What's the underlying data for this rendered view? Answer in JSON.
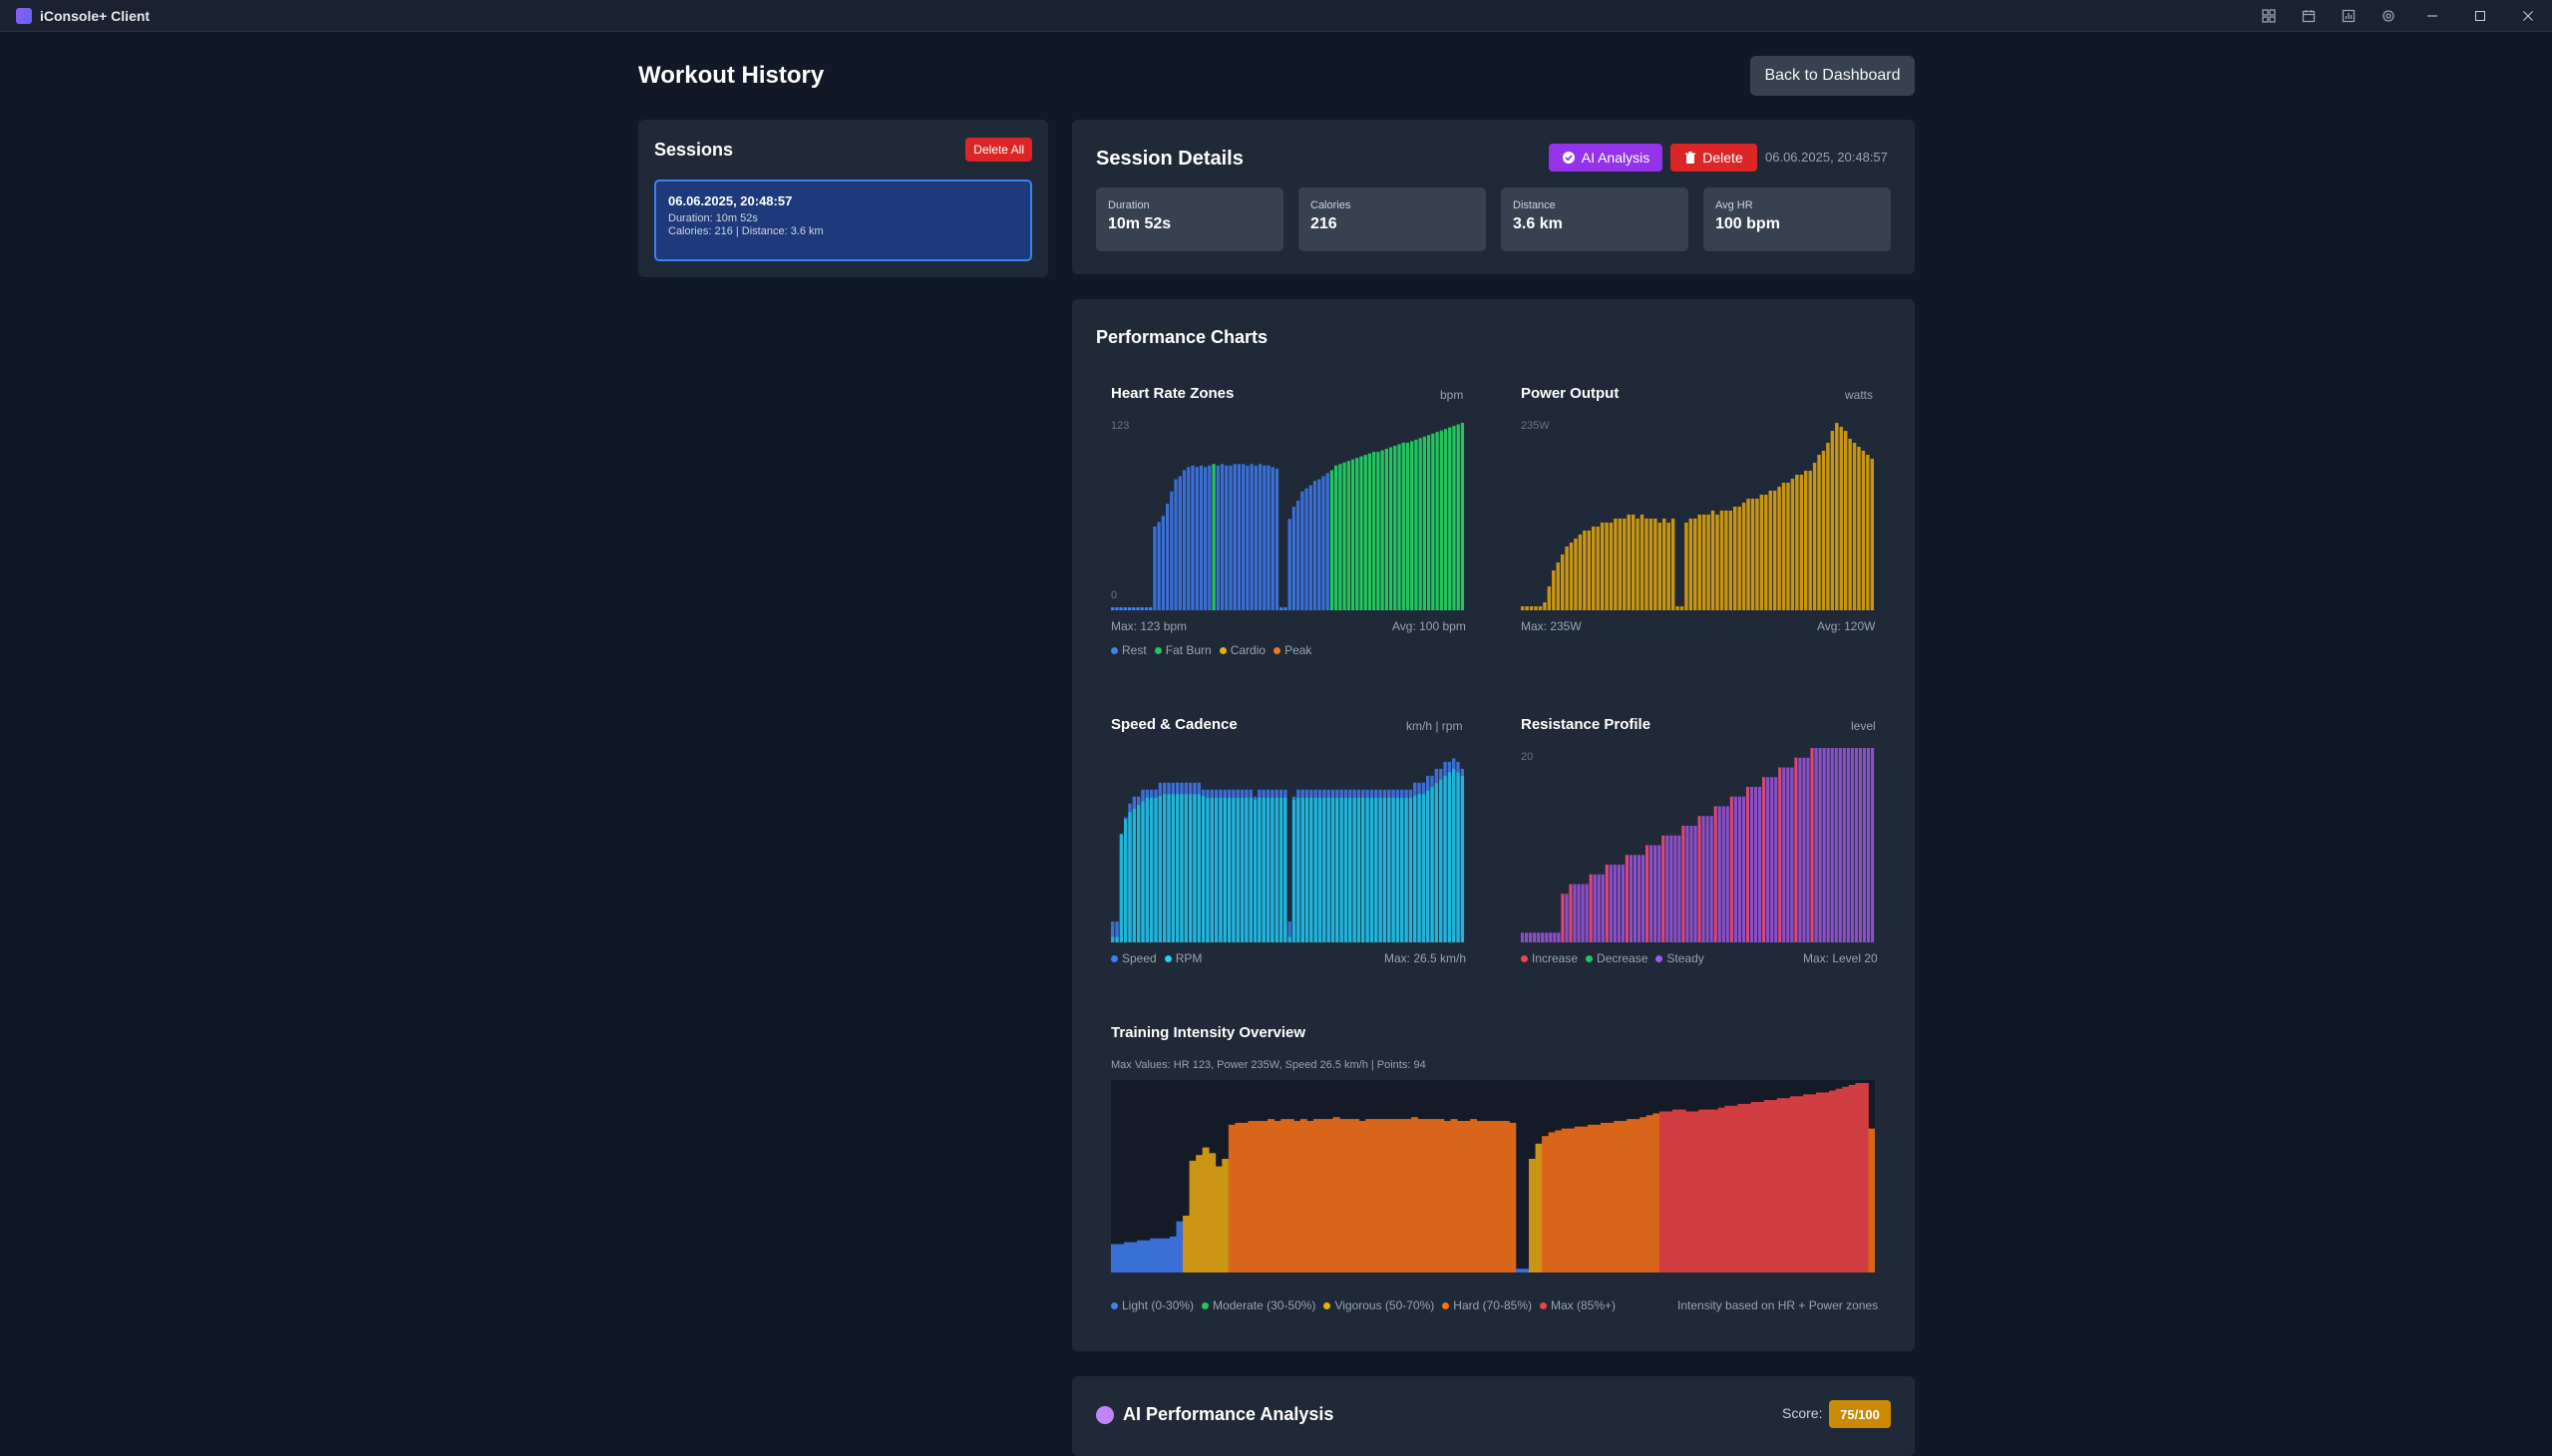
{
  "app": {
    "title": "iConsole+ Client"
  },
  "page": {
    "title": "Workout History",
    "back_label": "Back to Dashboard"
  },
  "sessions": {
    "title": "Sessions",
    "delete_all_label": "Delete All",
    "items": [
      {
        "date": "06.06.2025, 20:48:57",
        "line1": "Duration: 10m 52s",
        "line2": "Calories: 216 | Distance: 3.6 km"
      }
    ]
  },
  "details": {
    "title": "Session Details",
    "ai_label": "AI Analysis",
    "delete_label": "Delete",
    "date": "06.06.2025, 20:48:57",
    "stats": [
      {
        "label": "Duration",
        "value": "10m 52s"
      },
      {
        "label": "Calories",
        "value": "216"
      },
      {
        "label": "Distance",
        "value": "3.6 km"
      },
      {
        "label": "Avg HR",
        "value": "100 bpm"
      }
    ]
  },
  "charts": {
    "title": "Performance Charts",
    "hr": {
      "title": "Heart Rate Zones",
      "unit": "bpm",
      "ymax": "123",
      "ymin": "0",
      "max_text": "Max: 123 bpm",
      "avg_text": "Avg: 100 bpm",
      "legend": [
        "Rest",
        "Fat Burn",
        "Cardio",
        "Peak"
      ]
    },
    "power": {
      "title": "Power Output",
      "unit": "watts",
      "ymax": "235W",
      "max_text": "Max: 235W",
      "avg_text": "Avg: 120W"
    },
    "speed": {
      "title": "Speed & Cadence",
      "unit": "km/h | rpm",
      "legend": [
        "Speed",
        "RPM"
      ],
      "max_text": "Max: 26.5 km/h"
    },
    "resistance": {
      "title": "Resistance Profile",
      "unit": "level",
      "ymax": "20",
      "legend": [
        "Increase",
        "Decrease",
        "Steady"
      ],
      "max_text": "Max: Level 20"
    },
    "intensity": {
      "title": "Training Intensity Overview",
      "subtitle": "Max Values: HR 123, Power 235W, Speed 26.5 km/h | Points: 94",
      "legend": [
        "Light (0-30%)",
        "Moderate (30-50%)",
        "Vigorous (50-70%)",
        "Hard (70-85%)",
        "Max (85%+)"
      ],
      "note": "Intensity based on HR + Power zones"
    }
  },
  "ai": {
    "title": "AI Performance Analysis",
    "score_label": "Score:",
    "score": "75/100"
  },
  "colors": {
    "rest": "#3b82f6",
    "fatburn": "#22c55e",
    "cardio": "#eab308",
    "peak": "#f97316",
    "max": "#ef4444",
    "purple": "#a855f7",
    "cyan": "#22d3ee"
  },
  "chart_data": [
    {
      "type": "bar",
      "title": "Heart Rate Zones",
      "ylim": [
        0,
        123
      ],
      "series": [
        {
          "name": "HR",
          "values": [
            2,
            2,
            2,
            2,
            2,
            2,
            2,
            2,
            2,
            2,
            55,
            58,
            62,
            70,
            78,
            86,
            88,
            92,
            94,
            95,
            94,
            95,
            94,
            95,
            96,
            95,
            96,
            95,
            95,
            96,
            96,
            96,
            95,
            96,
            95,
            96,
            95,
            95,
            94,
            93,
            2,
            2,
            60,
            68,
            72,
            78,
            80,
            82,
            85,
            86,
            88,
            90,
            92,
            95,
            96,
            97,
            98,
            99,
            100,
            101,
            102,
            103,
            104,
            104,
            105,
            106,
            107,
            108,
            109,
            110,
            110,
            111,
            112,
            113,
            114,
            115,
            116,
            117,
            118,
            119,
            120,
            121,
            122,
            123
          ]
        }
      ]
    },
    {
      "type": "bar",
      "title": "Power Output",
      "ylim": [
        0,
        235
      ],
      "series": [
        {
          "name": "Power",
          "values": [
            5,
            5,
            5,
            5,
            5,
            10,
            30,
            50,
            60,
            70,
            80,
            85,
            90,
            95,
            100,
            100,
            105,
            105,
            110,
            110,
            110,
            115,
            115,
            115,
            120,
            120,
            115,
            120,
            115,
            115,
            115,
            110,
            115,
            110,
            115,
            5,
            5,
            110,
            115,
            115,
            120,
            120,
            120,
            125,
            120,
            125,
            125,
            125,
            130,
            130,
            135,
            140,
            140,
            140,
            145,
            145,
            150,
            150,
            155,
            160,
            160,
            165,
            170,
            170,
            175,
            175,
            185,
            195,
            200,
            210,
            225,
            235,
            230,
            225,
            215,
            210,
            205,
            200,
            195,
            190
          ]
        }
      ]
    },
    {
      "type": "bar",
      "title": "Speed & Cadence",
      "series": [
        {
          "name": "Speed",
          "values": [
            3,
            3,
            13,
            18,
            20,
            21,
            21,
            22,
            22,
            22,
            22,
            23,
            23,
            23,
            23,
            23,
            23,
            23,
            23,
            23,
            23,
            22,
            22,
            22,
            22,
            22,
            22,
            22,
            22,
            22,
            22,
            22,
            22,
            21,
            22,
            22,
            22,
            22,
            22,
            22,
            22,
            3,
            21,
            22,
            22,
            22,
            22,
            22,
            22,
            22,
            22,
            22,
            22,
            22,
            22,
            22,
            22,
            22,
            22,
            22,
            22,
            22,
            22,
            22,
            22,
            22,
            22,
            22,
            22,
            22,
            23,
            23,
            23,
            24,
            24,
            25,
            25,
            26,
            26,
            26.5,
            26,
            25
          ]
        },
        {
          "name": "RPM",
          "values": [
            3,
            3,
            60,
            68,
            72,
            74,
            76,
            78,
            80,
            80,
            80,
            81,
            82,
            82,
            82,
            82,
            82,
            82,
            82,
            82,
            82,
            81,
            80,
            80,
            80,
            80,
            80,
            80,
            80,
            80,
            80,
            80,
            80,
            79,
            80,
            80,
            80,
            80,
            80,
            80,
            80,
            3,
            79,
            80,
            80,
            80,
            80,
            80,
            80,
            80,
            80,
            80,
            80,
            80,
            80,
            80,
            80,
            80,
            80,
            80,
            80,
            80,
            80,
            80,
            80,
            80,
            80,
            80,
            80,
            80,
            81,
            82,
            82,
            84,
            86,
            88,
            90,
            92,
            94,
            96,
            94,
            92
          ]
        }
      ]
    },
    {
      "type": "bar",
      "title": "Resistance Profile",
      "ylim": [
        0,
        20
      ],
      "series": [
        {
          "name": "Level",
          "values": [
            1,
            1,
            1,
            1,
            1,
            1,
            1,
            1,
            1,
            1,
            5,
            5,
            6,
            6,
            6,
            6,
            6,
            7,
            7,
            7,
            7,
            8,
            8,
            8,
            8,
            8,
            9,
            9,
            9,
            9,
            9,
            10,
            10,
            10,
            10,
            11,
            11,
            11,
            11,
            11,
            12,
            12,
            12,
            12,
            13,
            13,
            13,
            13,
            14,
            14,
            14,
            14,
            15,
            15,
            15,
            15,
            16,
            16,
            16,
            16,
            17,
            17,
            17,
            17,
            18,
            18,
            18,
            18,
            19,
            19,
            19,
            19,
            20,
            20,
            20,
            20,
            20,
            20,
            20,
            20,
            20,
            20,
            20,
            20,
            20,
            20,
            20,
            20
          ]
        }
      ]
    },
    {
      "type": "bar",
      "title": "Training Intensity Overview",
      "series": [
        {
          "name": "Intensity %",
          "values": [
            15,
            15,
            16,
            16,
            17,
            17,
            18,
            18,
            18,
            19,
            27,
            30,
            59,
            62,
            66,
            63,
            56,
            60,
            78,
            79,
            79,
            80,
            80,
            80,
            81,
            80,
            81,
            81,
            80,
            81,
            80,
            81,
            81,
            81,
            82,
            81,
            81,
            81,
            80,
            81,
            81,
            81,
            81,
            81,
            81,
            81,
            82,
            81,
            81,
            81,
            81,
            80,
            81,
            80,
            80,
            81,
            80,
            80,
            80,
            80,
            80,
            79,
            2,
            2,
            60,
            68,
            72,
            74,
            75,
            76,
            76,
            77,
            77,
            78,
            78,
            79,
            79,
            80,
            80,
            81,
            81,
            82,
            83,
            84,
            85,
            85,
            86,
            86,
            85,
            85,
            86,
            86,
            86,
            87,
            88,
            88,
            89,
            89,
            90,
            90,
            91,
            91,
            92,
            92,
            93,
            93,
            94,
            94,
            95,
            95,
            96,
            97,
            98,
            99,
            100,
            100,
            76
          ]
        }
      ]
    }
  ]
}
